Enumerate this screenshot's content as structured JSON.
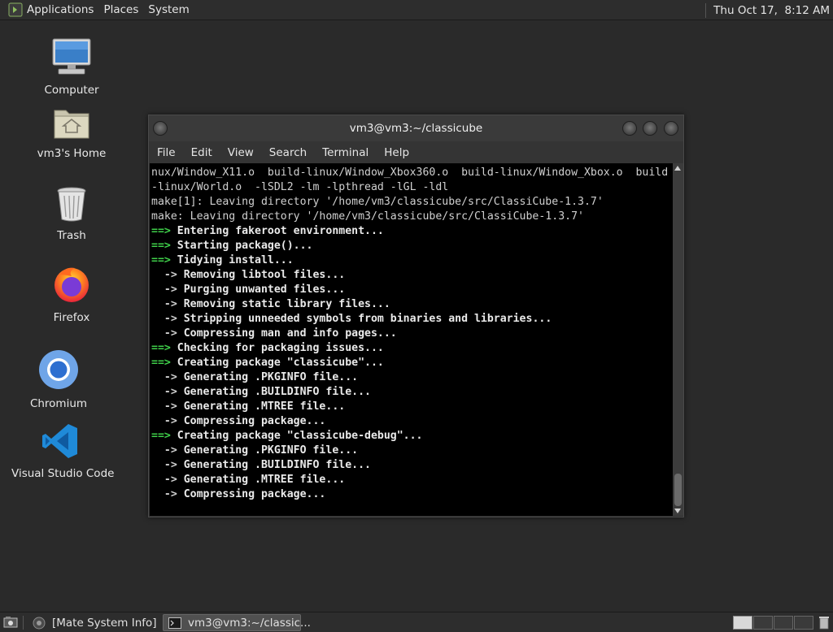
{
  "top_panel": {
    "menus": [
      "Applications",
      "Places",
      "System"
    ],
    "clock": "Thu Oct 17,  8:12 AM"
  },
  "desktop_icons": [
    {
      "label": "Computer",
      "icon": "computer-icon"
    },
    {
      "label": "vm3's Home",
      "icon": "home-folder-icon"
    },
    {
      "label": "Trash",
      "icon": "trash-icon"
    },
    {
      "label": "Firefox",
      "icon": "firefox-icon"
    },
    {
      "label": "Chromium",
      "icon": "chromium-icon"
    },
    {
      "label": "Visual Studio Code",
      "icon": "vscode-icon"
    }
  ],
  "terminal": {
    "title": "vm3@vm3:~/classicube",
    "menu": [
      "File",
      "Edit",
      "View",
      "Search",
      "Terminal",
      "Help"
    ],
    "lines": [
      {
        "prefix": "",
        "text": "nux/Window_X11.o  build-linux/Window_Xbox360.o  build-linux/Window_Xbox.o  build",
        "style": "plain"
      },
      {
        "prefix": "",
        "text": "-linux/World.o  -lSDL2 -lm -lpthread -lGL -ldl",
        "style": "plain"
      },
      {
        "prefix": "",
        "text": "make[1]: Leaving directory '/home/vm3/classicube/src/ClassiCube-1.3.7'",
        "style": "plain"
      },
      {
        "prefix": "",
        "text": "make: Leaving directory '/home/vm3/classicube/src/ClassiCube-1.3.7'",
        "style": "plain"
      },
      {
        "prefix": "==>",
        "text": " Entering fakeroot environment...",
        "style": "green"
      },
      {
        "prefix": "==>",
        "text": " Starting package()...",
        "style": "green"
      },
      {
        "prefix": "==>",
        "text": " Tidying install...",
        "style": "green"
      },
      {
        "prefix": "  ->",
        "text": " Removing libtool files...",
        "style": "sub"
      },
      {
        "prefix": "  ->",
        "text": " Purging unwanted files...",
        "style": "sub"
      },
      {
        "prefix": "  ->",
        "text": " Removing static library files...",
        "style": "sub"
      },
      {
        "prefix": "  ->",
        "text": " Stripping unneeded symbols from binaries and libraries...",
        "style": "sub"
      },
      {
        "prefix": "  ->",
        "text": " Compressing man and info pages...",
        "style": "sub"
      },
      {
        "prefix": "==>",
        "text": " Checking for packaging issues...",
        "style": "green"
      },
      {
        "prefix": "==>",
        "text": " Creating package \"classicube\"...",
        "style": "green"
      },
      {
        "prefix": "  ->",
        "text": " Generating .PKGINFO file...",
        "style": "sub"
      },
      {
        "prefix": "  ->",
        "text": " Generating .BUILDINFO file...",
        "style": "sub"
      },
      {
        "prefix": "  ->",
        "text": " Generating .MTREE file...",
        "style": "sub"
      },
      {
        "prefix": "  ->",
        "text": " Compressing package...",
        "style": "sub"
      },
      {
        "prefix": "==>",
        "text": " Creating package \"classicube-debug\"...",
        "style": "green"
      },
      {
        "prefix": "  ->",
        "text": " Generating .PKGINFO file...",
        "style": "sub"
      },
      {
        "prefix": "  ->",
        "text": " Generating .BUILDINFO file...",
        "style": "sub"
      },
      {
        "prefix": "  ->",
        "text": " Generating .MTREE file...",
        "style": "sub"
      },
      {
        "prefix": "  ->",
        "text": " Compressing package...",
        "style": "sub"
      }
    ]
  },
  "bottom_panel": {
    "tasks": [
      {
        "label": "[Mate System Info]",
        "active": false
      },
      {
        "label": "vm3@vm3:~/classic...",
        "active": true
      }
    ]
  },
  "colors": {
    "desktop": "#2a2a2a",
    "panel": "#2d2d2d",
    "terminal_bg": "#000000",
    "prompt_green": "#3fd14a"
  }
}
